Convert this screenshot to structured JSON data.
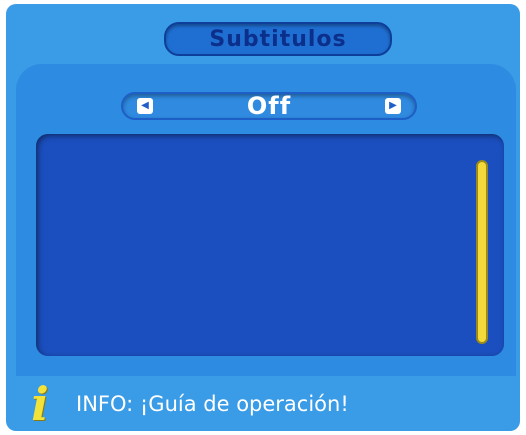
{
  "dialog": {
    "title": "Subtitulos",
    "selector": {
      "value": "Off",
      "left_arrow_icon": "triangle-left-icon",
      "right_arrow_icon": "triangle-right-icon"
    },
    "content": {
      "scrollbar_color": "#f3d93a"
    },
    "info": {
      "icon": "info-icon",
      "text": "INFO: ¡Guía de operación!"
    }
  },
  "colors": {
    "background": "#3a9be6",
    "content_area": "#1b4fbf",
    "accent_yellow": "#f3e23a"
  }
}
